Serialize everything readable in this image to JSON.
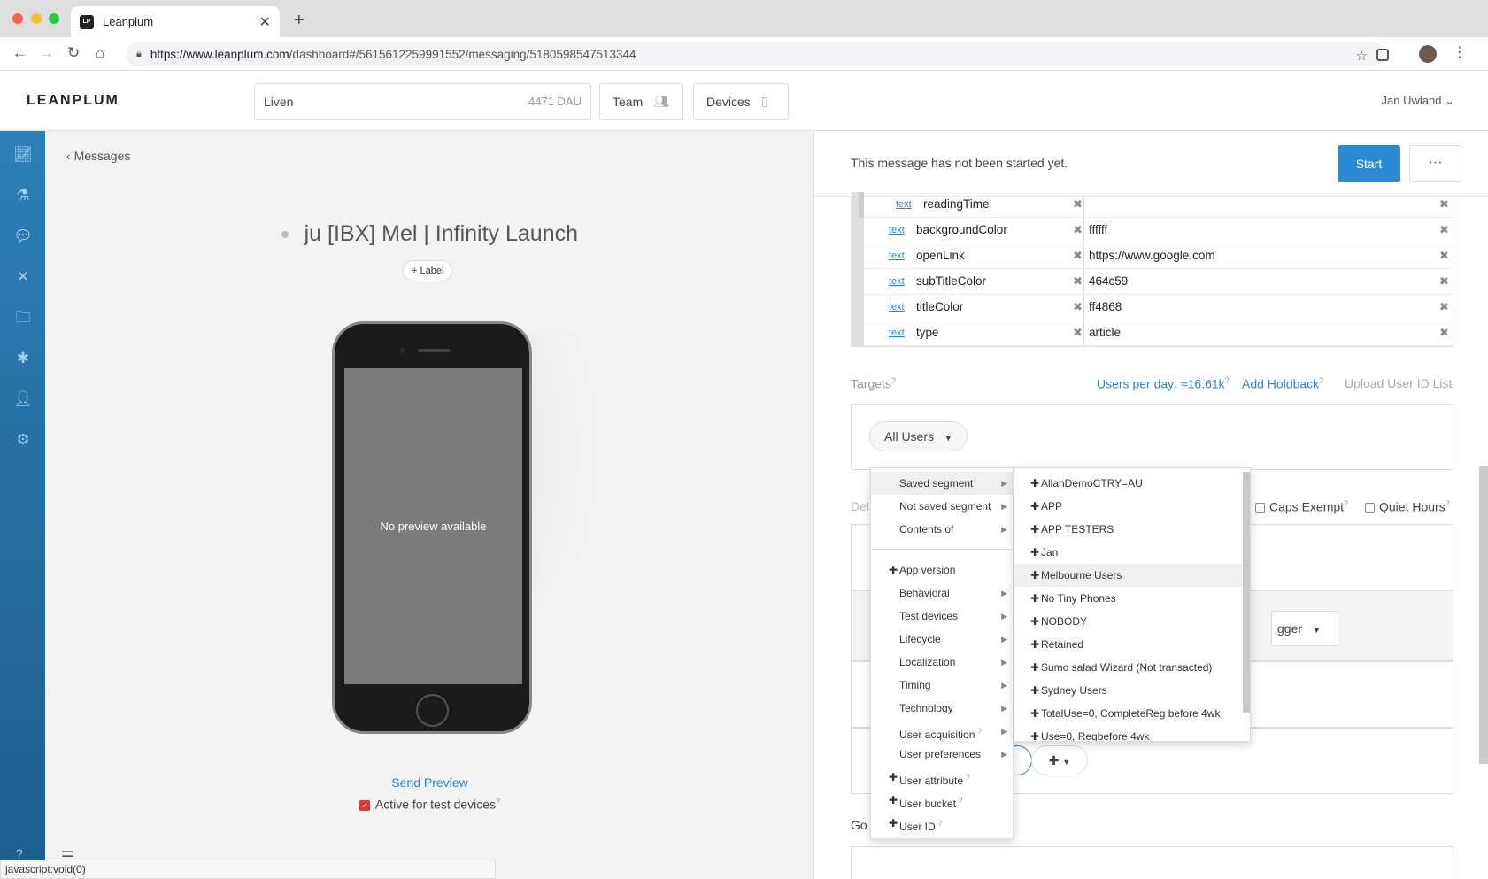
{
  "browser": {
    "tab_title": "Leanplum",
    "tab_favicon": "LP",
    "new_tab": "+",
    "url_host": "https://www.leanplum.com",
    "url_path": "/dashboard#/5615612259991552/messaging/5180598547513344"
  },
  "header": {
    "logo": "LEANPLUM",
    "app_name": "Liven",
    "app_dau": "4471 DAU",
    "team_label": "Team",
    "devices_label": "Devices",
    "user_name": "Jan Uwland"
  },
  "left": {
    "back_label": "Messages",
    "message_title": "ju [IBX] Mel | Infinity Launch",
    "label_button": "+ Label",
    "no_preview": "No preview available",
    "send_preview": "Send Preview",
    "active_test": "Active for test devices",
    "status_tip": "javascript:void(0)"
  },
  "status": {
    "text": "This message has not been started yet.",
    "start": "Start",
    "more": "···"
  },
  "fields": [
    {
      "type": "text",
      "key": "readingTime",
      "value": ""
    },
    {
      "type": "text",
      "key": "backgroundColor",
      "value": "ffffff"
    },
    {
      "type": "text",
      "key": "openLink",
      "value": "https://www.google.com"
    },
    {
      "type": "text",
      "key": "subTitleColor",
      "value": "464c59"
    },
    {
      "type": "text",
      "key": "titleColor",
      "value": "ff4868"
    },
    {
      "type": "text",
      "key": "type",
      "value": "article"
    }
  ],
  "targets": {
    "label": "Targets",
    "users_per_day": "Users per day: ≈16.61k",
    "add_holdback": "Add Holdback",
    "upload": "Upload User ID List",
    "all_users": "All Users"
  },
  "delivery": {
    "label": "Del",
    "caps_exempt": "Caps Exempt",
    "quiet_hours": "Quiet Hours",
    "trigger": "gger",
    "goals": "Go"
  },
  "menu1": {
    "items": [
      {
        "label": "Saved segment",
        "arrow": true,
        "plus": false
      },
      {
        "label": "Not saved segment",
        "arrow": true,
        "plus": false
      },
      {
        "label": "Contents of",
        "arrow": true,
        "plus": false
      },
      {
        "label": "App version",
        "arrow": false,
        "plus": true
      },
      {
        "label": "Behavioral",
        "arrow": true,
        "plus": false
      },
      {
        "label": "Test devices",
        "arrow": true,
        "plus": false
      },
      {
        "label": "Lifecycle",
        "arrow": true,
        "plus": false
      },
      {
        "label": "Localization",
        "arrow": true,
        "plus": false
      },
      {
        "label": "Timing",
        "arrow": true,
        "plus": false
      },
      {
        "label": "Technology",
        "arrow": true,
        "plus": false
      },
      {
        "label": "User acquisition",
        "arrow": true,
        "plus": false
      },
      {
        "label": "User preferences",
        "arrow": true,
        "plus": false
      },
      {
        "label": "User attribute",
        "arrow": false,
        "plus": true
      },
      {
        "label": "User bucket",
        "arrow": false,
        "plus": true
      },
      {
        "label": "User ID",
        "arrow": false,
        "plus": true
      }
    ]
  },
  "menu2": {
    "items": [
      "AllanDemoCTRY=AU",
      "APP",
      "APP TESTERS",
      "Jan",
      "Melbourne Users",
      "No Tiny Phones",
      "NOBODY",
      "Retained",
      "Sumo salad Wizard (Not transacted)",
      "Sydney Users",
      "TotalUse=0, CompleteReg before 4wk",
      "Use=0, Regbefore 4wk"
    ]
  },
  "colors": {
    "accent": "#2a8ad4",
    "rail": "#1c5f8f",
    "link": "#2a86c9"
  }
}
